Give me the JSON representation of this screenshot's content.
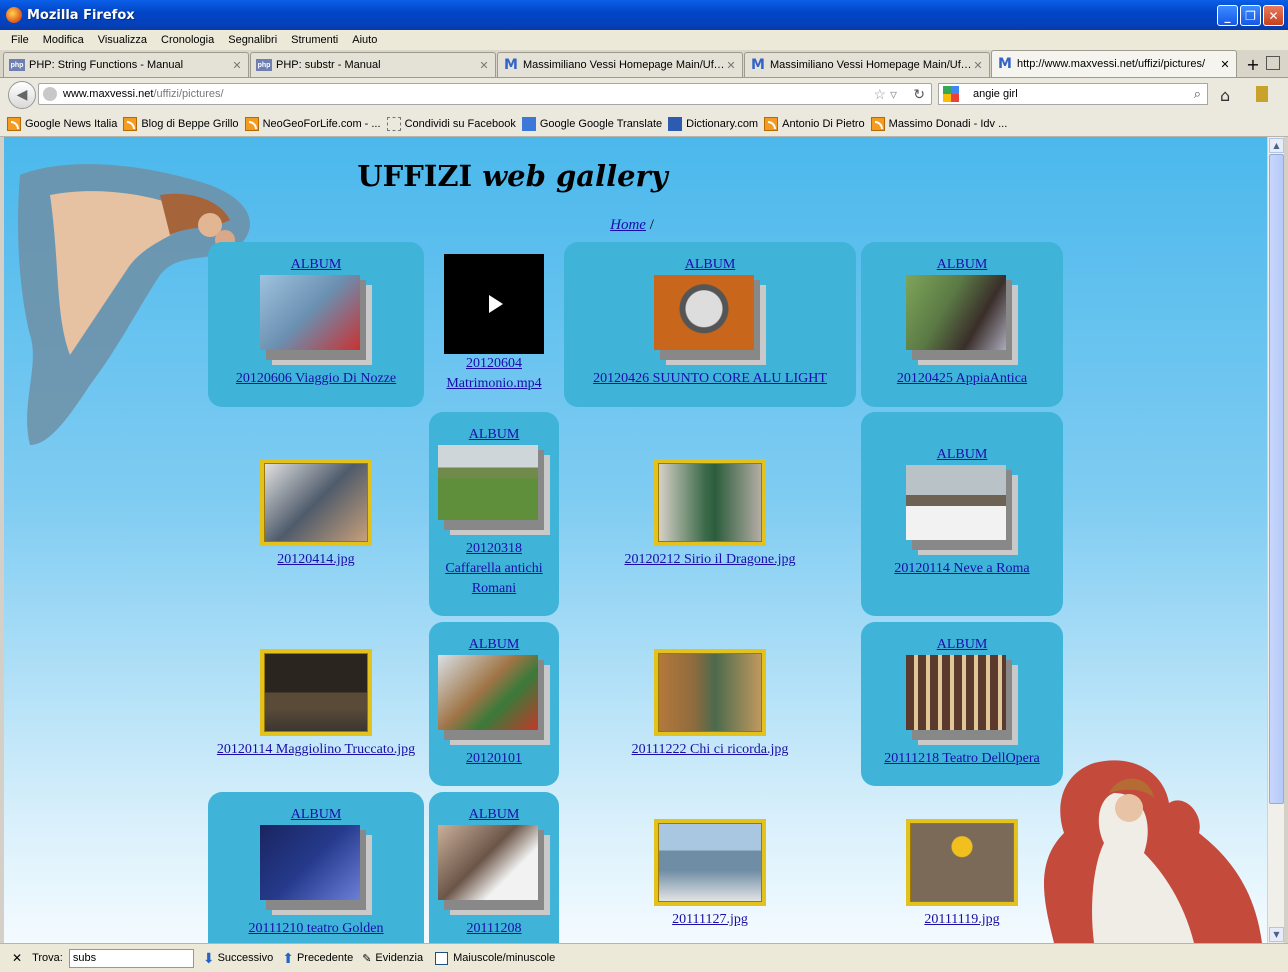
{
  "window": {
    "title": "Mozilla Firefox"
  },
  "menu": [
    "File",
    "Modifica",
    "Visualizza",
    "Cronologia",
    "Segnalibri",
    "Strumenti",
    "Aiuto"
  ],
  "tabs": [
    {
      "label": "PHP: String Functions - Manual",
      "icon": "php-icon"
    },
    {
      "label": "PHP: substr - Manual",
      "icon": "php-icon"
    },
    {
      "label": "Massimiliano Vessi Homepage Main/Uffizi...",
      "icon": "m-icon"
    },
    {
      "label": "Massimiliano Vessi Homepage Main/Uffizi...",
      "icon": "m-icon"
    },
    {
      "label": "http://www.maxvessi.net/uffizi/pictures/",
      "icon": "m-icon"
    }
  ],
  "nav": {
    "url_host": "www.maxvessi.net",
    "url_path": "/uffizi/pictures/",
    "search_value": "angie girl"
  },
  "bookmarks": [
    {
      "label": "Google News Italia",
      "icon": "rss"
    },
    {
      "label": "Blog di Beppe Grillo",
      "icon": "rss"
    },
    {
      "label": "NeoGeoForLife.com - ...",
      "icon": "rss"
    },
    {
      "label": "Condividi su Facebook",
      "icon": "dash"
    },
    {
      "label": "Google Google Translate",
      "icon": "gt"
    },
    {
      "label": "Dictionary.com",
      "icon": "dict"
    },
    {
      "label": "Antonio Di Pietro",
      "icon": "rss"
    },
    {
      "label": "Massimo Donadi - Idv ...",
      "icon": "rss"
    }
  ],
  "page": {
    "title_main": "UFFIZI",
    "title_italic": "web gallery",
    "breadcrumb_home": "Home",
    "breadcrumb_sep": "/",
    "album_label": "ALBUM",
    "items": [
      {
        "caption": "20120606 Viaggio Di Nozze",
        "type": "album",
        "color": "#6b8fb0"
      },
      {
        "caption": "20120604 Matrimonio.mp4",
        "type": "video",
        "color": "#000000"
      },
      {
        "caption": "20120426 SUUNTO CORE ALU LIGHT",
        "type": "album",
        "color": "#c8661b"
      },
      {
        "caption": "20120425 AppiaAntica",
        "type": "album",
        "color": "#5b7a45"
      },
      {
        "caption": "20120414.jpg",
        "type": "image",
        "color": "#4f5b6b"
      },
      {
        "caption": "20120318 Caffarella antichi Romani",
        "type": "album",
        "color": "#5f8f3a"
      },
      {
        "caption": "20120212 Sirio il Dragone.jpg",
        "type": "image",
        "color": "#3d6b4a"
      },
      {
        "caption": "20120114 Neve a Roma",
        "type": "album",
        "color": "#8a8d8f"
      },
      {
        "caption": "20120114 Maggiolino Truccato.jpg",
        "type": "image",
        "color": "#2b2520"
      },
      {
        "caption": "20120101",
        "type": "album",
        "color": "#a07446"
      },
      {
        "caption": "20111222 Chi ci ricorda.jpg",
        "type": "image",
        "color": "#8d6b3e"
      },
      {
        "caption": "20111218 Teatro DellOpera",
        "type": "album",
        "color": "#5b3a2d"
      },
      {
        "caption": "20111210 teatro Golden",
        "type": "album",
        "color": "#253a8c"
      },
      {
        "caption": "20111208",
        "type": "album",
        "color": "#6b5547"
      },
      {
        "caption": "20111127.jpg",
        "type": "image",
        "color": "#6f8ea6"
      },
      {
        "caption": "20111119.jpg",
        "type": "image",
        "color": "#7b6a58"
      }
    ]
  },
  "findbar": {
    "label": "Trova:",
    "value": "subs",
    "next": "Successivo",
    "prev": "Precedente",
    "highlight": "Evidenzia",
    "matchcase": "Maiuscole/minuscole"
  }
}
